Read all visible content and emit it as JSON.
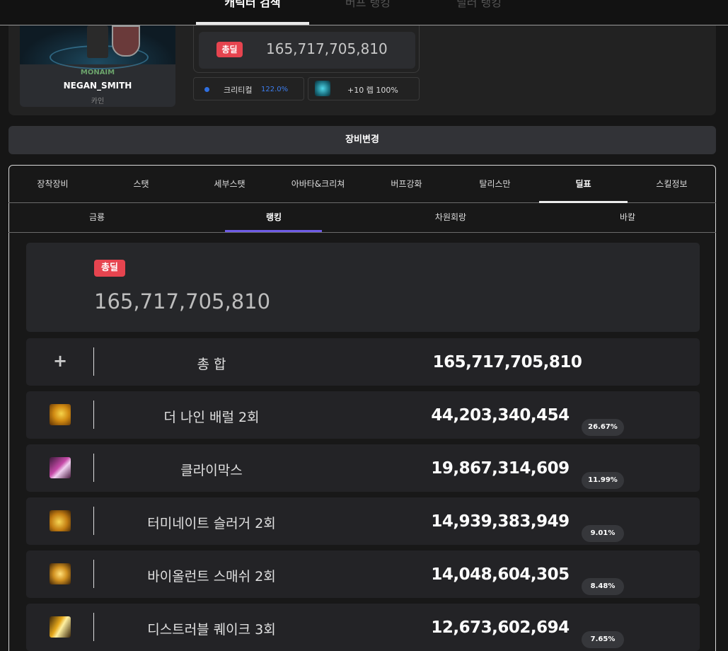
{
  "top_nav": {
    "tabs": [
      {
        "label": "캐릭터 검색",
        "active": true
      },
      {
        "label": "버프 랭킹",
        "active": false
      },
      {
        "label": "딜러 랭킹",
        "active": false
      }
    ]
  },
  "character": {
    "guild": "MONAIM",
    "name": "NEGAN_SMITH",
    "job": "카인"
  },
  "total_box": {
    "badge": "총딜",
    "value": "165,717,705,810"
  },
  "stats": {
    "crit_label": "크리티컬",
    "crit_value": "122.0%",
    "level_label": "+10 렙 100%"
  },
  "equip_button": "장비변경",
  "main_tabs": [
    "장착장비",
    "스탯",
    "세부스탯",
    "아바타&크리쳐",
    "버프강화",
    "탈리스만",
    "딜표",
    "스킬정보"
  ],
  "main_tab_active": "딜표",
  "sub_tabs": [
    "금룡",
    "랭킹",
    "차원회랑",
    "바칼"
  ],
  "sub_tab_active": "랭킹",
  "summary": {
    "badge": "총딜",
    "value": "165,717,705,810"
  },
  "total_row": {
    "icon": "+",
    "name": "총 합",
    "damage": "165,717,705,810"
  },
  "skills": [
    {
      "icon": "skill-icon-nine-barrel",
      "name": "더 나인 배럴 2회",
      "damage": "44,203,340,454",
      "percent": "26.67%"
    },
    {
      "icon": "skill-icon-climax",
      "name": "클라이막스",
      "damage": "19,867,314,609",
      "percent": "11.99%"
    },
    {
      "icon": "skill-icon-terminate-slugger",
      "name": "터미네이트 슬러거 2회",
      "damage": "14,939,383,949",
      "percent": "9.01%"
    },
    {
      "icon": "skill-icon-violent-smash",
      "name": "바이올런트 스매쉬 2회",
      "damage": "14,048,604,305",
      "percent": "8.48%"
    },
    {
      "icon": "skill-icon-disturbable-quake",
      "name": "디스트러블 퀘이크 3회",
      "damage": "12,673,602,694",
      "percent": "7.65%"
    }
  ],
  "colors": {
    "badge_red": "#e6444f",
    "crit_blue": "#3d7ef0",
    "sub_tab_underline": "#6e5ce6",
    "guild_green": "#6ba36b"
  }
}
